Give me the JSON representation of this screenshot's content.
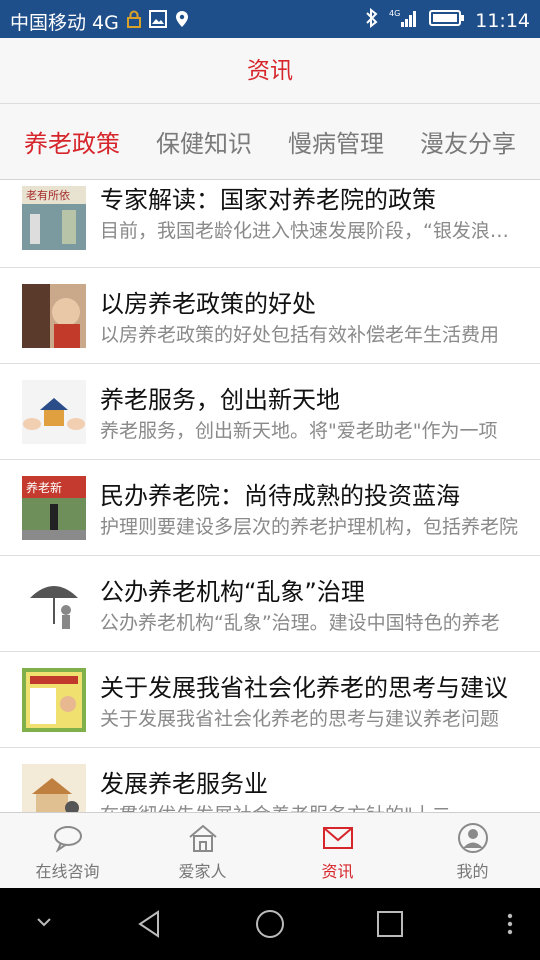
{
  "status_bar": {
    "carrier": "中国移动 4G",
    "network": "4G",
    "time": "11:14"
  },
  "title": "资讯",
  "tabs": [
    {
      "label": "养老政策",
      "active": true
    },
    {
      "label": "保健知识",
      "active": false
    },
    {
      "label": "慢病管理",
      "active": false
    },
    {
      "label": "漫友分享",
      "active": false
    }
  ],
  "articles": [
    {
      "title": "专家解读：国家对养老院的政策",
      "summary": "目前，我国老龄化进入快速发展阶段，“银发浪潮”"
    },
    {
      "title": "以房养老政策的好处",
      "summary": "以房养老政策的好处包括有效补偿老年生活费用"
    },
    {
      "title": "养老服务，创出新天地",
      "summary": "养老服务，创出新天地。将\"爱老助老\"作为一项"
    },
    {
      "title": "民办养老院：尚待成熟的投资蓝海",
      "summary": "护理则要建设多层次的养老护理机构，包括养老院"
    },
    {
      "title": "公办养老机构“乱象”治理",
      "summary": "公办养老机构“乱象”治理。建设中国特色的养老"
    },
    {
      "title": "关于发展我省社会化养老的思考与建议",
      "summary": "关于发展我省社会化养老的思考与建议养老问题"
    },
    {
      "title": "发展养老服务业",
      "summary": "在贯彻优先发展社会养老服务方针的\"十二"
    }
  ],
  "bottom_nav": [
    {
      "label": "在线咨询",
      "icon": "chat-bubble-icon",
      "active": false
    },
    {
      "label": "爱家人",
      "icon": "home-icon",
      "active": false
    },
    {
      "label": "资讯",
      "icon": "mail-icon",
      "active": true
    },
    {
      "label": "我的",
      "icon": "user-icon",
      "active": false
    }
  ],
  "colors": {
    "accent": "#d6262b",
    "status_bar": "#1f4f8a",
    "inactive_text": "#7a7a7a"
  }
}
